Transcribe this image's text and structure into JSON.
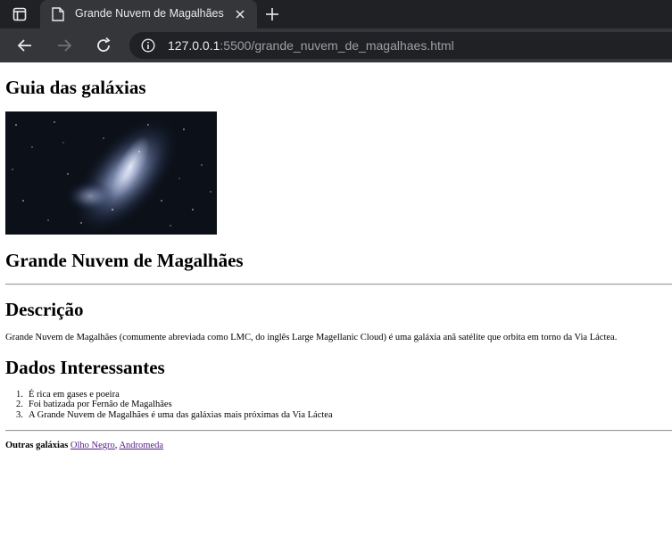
{
  "browser": {
    "tab_title": "Grande Nuvem de Magalhães",
    "url_host": "127.0.0.1",
    "url_rest": ":5500/grande_nuvem_de_magalhaes.html"
  },
  "page": {
    "site_title": "Guia das galáxias",
    "galaxy_title": "Grande Nuvem de Magalhães",
    "description_heading": "Descrição",
    "description_text": "Grande Nuvem de Magalhães (comumente abreviada como LMC, do inglês Large Magellanic Cloud) é uma galáxia anã satélite que orbita em torno da Via Láctea.",
    "facts_heading": "Dados Interessantes",
    "facts": [
      {
        "num": "1.",
        "text": "É rica em gases e poeira"
      },
      {
        "num": "2.",
        "text": "Foi batizada por Fernão de Magalhães"
      },
      {
        "num": "3.",
        "text": "A Grande Nuvem de Magalhães é uma das galáxias mais próximas da Via Láctea"
      }
    ],
    "other_label": "Outras galáxias",
    "other_links": [
      {
        "text": "Olho Negro"
      },
      {
        "text": "Andromeda"
      }
    ],
    "link_separator": ", "
  },
  "colors": {
    "tabbar_bg": "#202124",
    "toolbar_bg": "#35363a",
    "visited_link": "#551a8b"
  }
}
